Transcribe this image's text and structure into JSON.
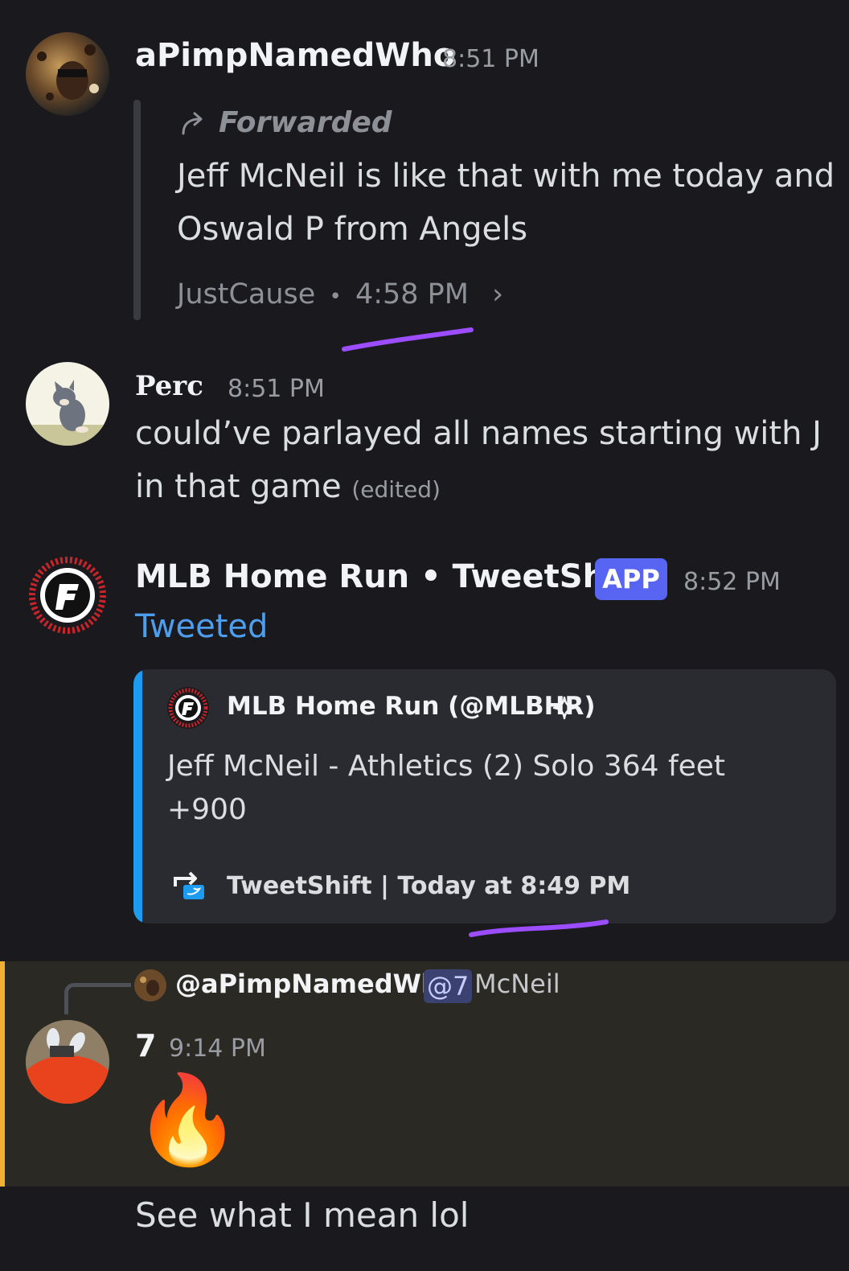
{
  "messages": [
    {
      "username": "aPimpNamedWho",
      "time": "8:51 PM",
      "forward": {
        "label": "Forwarded",
        "line1": "Jeff McNeil is like that with me today and",
        "line2": "Oswald P from Angels",
        "source": "JustCause",
        "separator": "•",
        "source_time": "4:58 PM",
        "chevron": "›"
      }
    },
    {
      "username": "Perc",
      "time": "8:51 PM",
      "line1": "could’ve parlayed all  names starting with J",
      "line2": "in that game",
      "edited": "(edited)"
    },
    {
      "username": "MLB Home Run • TweetShift",
      "badge": "APP",
      "time": "8:52 PM",
      "action": "Tweeted",
      "embed": {
        "author": "MLB Home Run (@MLBHR)",
        "author_icon": "sparkle-outline-icon",
        "line1": "Jeff McNeil - Athletics (2) Solo 364 feet",
        "line2": "+900",
        "footer": "TweetShift | Today at 8:49 PM"
      }
    },
    {
      "reply_to_user": "@aPimpNamedWho",
      "reply_mention": "@7",
      "reply_text": "McNeil",
      "username": "7",
      "time": "9:14 PM",
      "emoji": "🔥",
      "followup": "See what I mean lol"
    }
  ],
  "colors": {
    "background": "#1a1a1e",
    "app_badge": "#5865f2",
    "tweeted_link": "#4e9ef0",
    "embed_bar": "#1d9bf0",
    "mention_highlight": "#f0b132",
    "annotation_underline": "#9b4dff"
  }
}
